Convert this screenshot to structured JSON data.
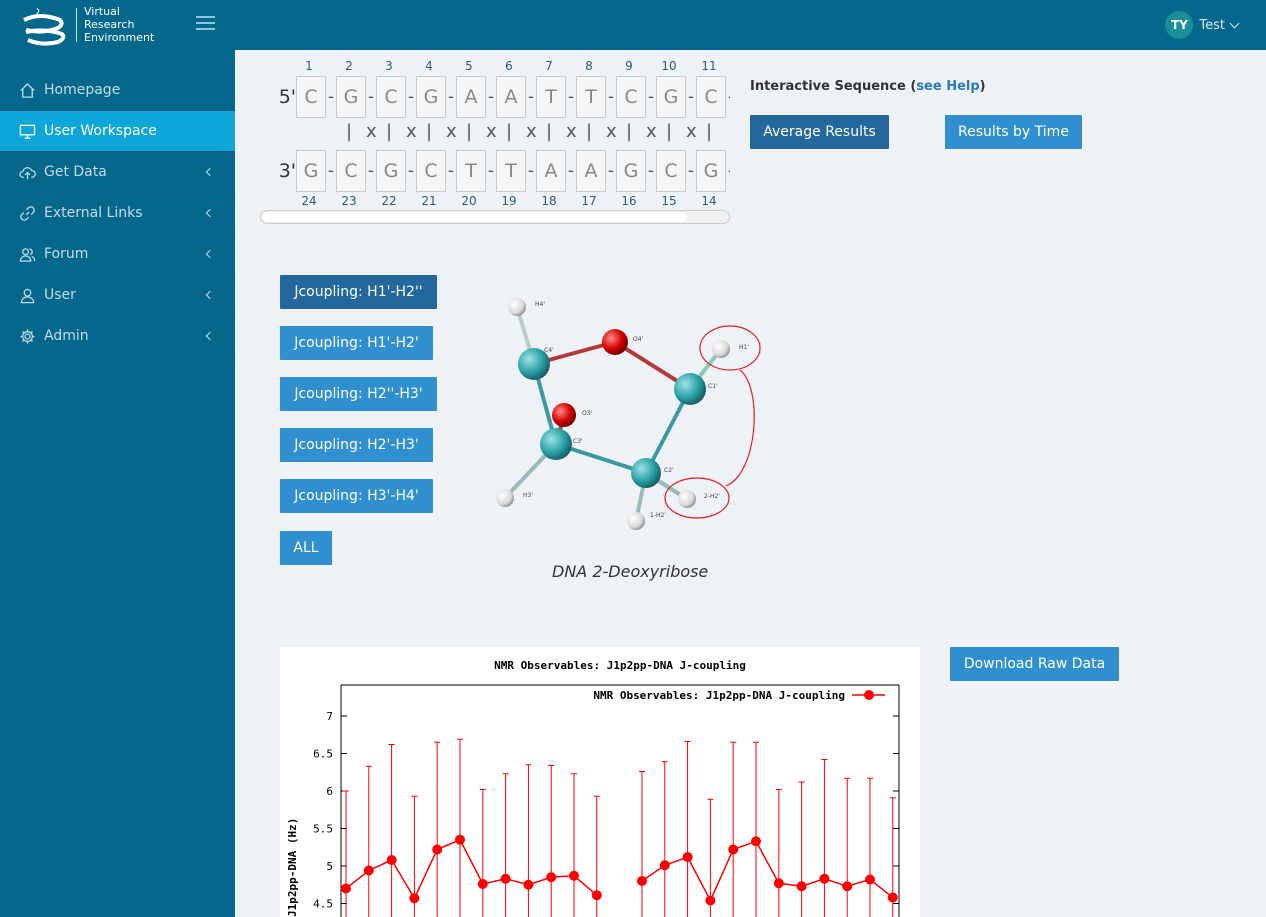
{
  "header": {
    "logo_lines": [
      "Virtual",
      "Research",
      "Environment"
    ],
    "user_initials": "TY",
    "user_name": "Test"
  },
  "sidebar": {
    "items": [
      {
        "label": "Homepage",
        "icon": "home-icon"
      },
      {
        "label": "User Workspace",
        "icon": "monitor-icon",
        "active": true
      },
      {
        "label": "Get Data",
        "icon": "cloud-upload-icon"
      },
      {
        "label": "External Links",
        "icon": "link-icon"
      },
      {
        "label": "Forum",
        "icon": "users-icon"
      },
      {
        "label": "User",
        "icon": "user-icon"
      },
      {
        "label": "Admin",
        "icon": "gear-icon"
      }
    ]
  },
  "sequence": {
    "top_prime": "5'",
    "bottom_prime": "3'",
    "top_bases": [
      "C",
      "G",
      "C",
      "G",
      "A",
      "A",
      "T",
      "T",
      "C",
      "G",
      "C"
    ],
    "bottom_bases": [
      "G",
      "C",
      "G",
      "C",
      "T",
      "T",
      "A",
      "A",
      "G",
      "C",
      "G"
    ],
    "top_numbers": [
      "1",
      "2",
      "3",
      "4",
      "5",
      "6",
      "7",
      "8",
      "9",
      "10",
      "11"
    ],
    "bottom_numbers": [
      "24",
      "23",
      "22",
      "21",
      "20",
      "19",
      "18",
      "17",
      "16",
      "15",
      "14"
    ],
    "pair_marks": [
      "|",
      "x",
      "|",
      "x",
      "|",
      "x",
      "|",
      "x",
      "|",
      "x",
      "|",
      "x",
      "|",
      "x",
      "|",
      "x",
      "|",
      "x",
      "|"
    ]
  },
  "interactive": {
    "title_prefix": "Interactive Sequence (",
    "help_link": "see Help",
    "title_suffix": ")",
    "average_button": "Average Results",
    "time_button": "Results by Time"
  },
  "jcoupling_buttons": [
    "Jcoupling: H1'-H2''",
    "Jcoupling: H1'-H2'",
    "Jcoupling: H2''-H3'",
    "Jcoupling: H2'-H3'",
    "Jcoupling: H3'-H4'",
    "ALL"
  ],
  "molecule": {
    "caption": "DNA 2-Deoxyribose",
    "atom_labels": [
      "H4'",
      "O4'",
      "C4'",
      "H1'",
      "C1'",
      "O3'",
      "C3'",
      "C2'",
      "H3'",
      "2-H2'",
      "1-H2'"
    ],
    "colors": {
      "carbon": "#2aa0a8",
      "oxygen": "#d40000",
      "hydrogen": "#e8e8e8",
      "highlight": "#e02020"
    }
  },
  "download_button": "Download Raw Data",
  "chart_data": {
    "type": "line",
    "title": "NMR Observables: J1p2pp-DNA J-coupling",
    "ylabel": "J1p2pp-DNA (Hz)",
    "ylim_visible": [
      4.4,
      7.4
    ],
    "yticks": [
      "7",
      "6.5",
      "6",
      "5.5",
      "5",
      "4.5"
    ],
    "series": [
      {
        "name": "NMR Observables: J1p2pp-DNA J-coupling",
        "color": "#ff0000",
        "segments": [
          {
            "values": [
              4.7,
              4.94,
              5.08,
              4.57,
              5.22,
              5.35,
              4.76,
              4.83,
              4.75,
              4.85,
              4.87,
              4.61
            ],
            "errors_upper": [
              6.0,
              6.33,
              6.62,
              5.93,
              6.65,
              6.69,
              6.02,
              6.23,
              6.35,
              6.34,
              6.23,
              5.93
            ]
          },
          {
            "values": [
              4.8,
              5.01,
              5.12,
              4.54,
              5.22,
              5.33,
              4.77,
              4.73,
              4.83,
              4.73,
              4.82,
              4.58
            ],
            "errors_upper": [
              6.26,
              6.39,
              6.66,
              5.89,
              6.65,
              6.65,
              6.02,
              6.12,
              6.42,
              6.17,
              6.17,
              5.91
            ]
          }
        ]
      }
    ],
    "legend": "top-right",
    "grid": false
  },
  "colors": {
    "topbar": "#06678c",
    "active": "#0ea5d9",
    "button": "#3090cf",
    "button_dark": "#23679d"
  }
}
